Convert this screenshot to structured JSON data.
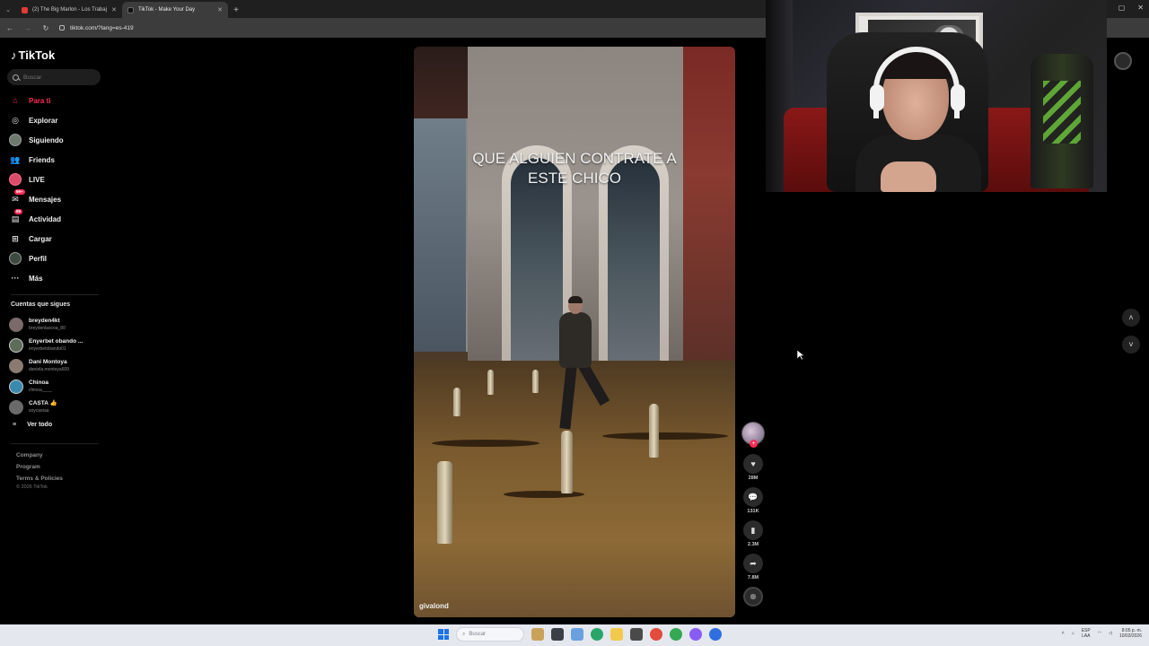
{
  "browser": {
    "tabs": [
      {
        "title": "(2) The Big Marlon - Los Trabaj",
        "active": false,
        "favicon_color": "#e53935"
      },
      {
        "title": "TikTok - Make Your Day",
        "active": true,
        "favicon_color": "#111111"
      }
    ],
    "url": "tiktok.com/?lang=es-419"
  },
  "sidebar": {
    "logo_text": "TikTok",
    "search_placeholder": "Buscar",
    "nav": [
      {
        "label": "Para ti",
        "icon": "home-icon",
        "active": true
      },
      {
        "label": "Explorar",
        "icon": "compass-icon",
        "active": false
      },
      {
        "label": "Siguiendo",
        "icon": "following-avatar-icon",
        "active": false
      },
      {
        "label": "Friends",
        "icon": "friends-icon",
        "active": false
      },
      {
        "label": "LIVE",
        "icon": "live-icon",
        "active": false
      },
      {
        "label": "Mensajes",
        "icon": "messages-icon",
        "active": false,
        "badge": "99+"
      },
      {
        "label": "Actividad",
        "icon": "activity-icon",
        "active": false,
        "badge": "99"
      },
      {
        "label": "Cargar",
        "icon": "upload-icon",
        "active": false
      },
      {
        "label": "Perfil",
        "icon": "profile-avatar-icon",
        "active": false
      },
      {
        "label": "Más",
        "icon": "more-icon",
        "active": false
      }
    ],
    "following_title": "Cuentas que sigues",
    "following": [
      {
        "name": "breyden4kt",
        "handle": "breydenlascoa_80",
        "color": "#7a6a6a"
      },
      {
        "name": "Enyerbet obando ...",
        "handle": "enyerbetobando01",
        "color": "#5d6d5a"
      },
      {
        "name": "Dani Montoya",
        "handle": "daniela.montoya609",
        "color": "#8a7a70"
      },
      {
        "name": "Chinoa",
        "handle": "chinoa____",
        "color": "#3a8ab0"
      },
      {
        "name": "CASTA 👍",
        "handle": "soycastaa",
        "color": "#6a6a6a"
      }
    ],
    "see_all": "Ver todo",
    "footer": [
      "Company",
      "Program",
      "Terms & Policies"
    ],
    "copyright": "© 2026 TikTok"
  },
  "video": {
    "caption_line1": "QUE ALGUIEN CONTRATE A",
    "caption_line2": "ESTE CHICO",
    "watermark": "givalond"
  },
  "actions": {
    "likes": "28M",
    "comments": "131K",
    "saves": "2.3M",
    "shares": "7.8M"
  },
  "taskbar": {
    "search_placeholder": "Buscar",
    "lang_line1": "ESP",
    "lang_line2": "LAA",
    "time": "8:05 p. m.",
    "date": "10/03/2026"
  }
}
